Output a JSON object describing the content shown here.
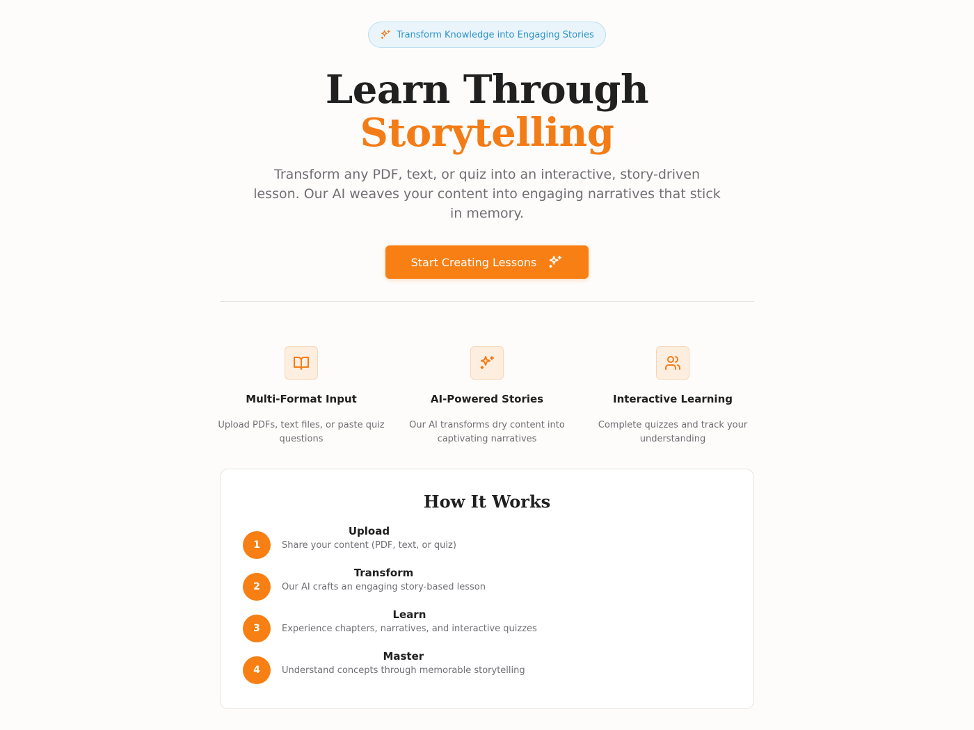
{
  "badge": {
    "icon": "sparkles-icon",
    "text": "Transform Knowledge into Engaging Stories"
  },
  "hero": {
    "title_line1": "Learn Through",
    "title_line2": "Storytelling",
    "subtitle": "Transform any PDF, text, or quiz into an interactive, story-driven lesson. Our AI weaves your content into engaging narratives that stick in memory.",
    "cta_label": "Start Creating Lessons",
    "cta_icon": "sparkles-icon"
  },
  "features": [
    {
      "icon": "book-open-icon",
      "title": "Multi-Format Input",
      "description": "Upload PDFs, text files, or paste quiz questions"
    },
    {
      "icon": "sparkles-icon",
      "title": "AI-Powered Stories",
      "description": "Our AI transforms dry content into captivating narratives"
    },
    {
      "icon": "users-icon",
      "title": "Interactive Learning",
      "description": "Complete quizzes and track your understanding"
    }
  ],
  "how_it_works": {
    "heading": "How It Works",
    "steps": [
      {
        "number": "1",
        "title": "Upload",
        "description": "Share your content (PDF, text, or quiz)"
      },
      {
        "number": "2",
        "title": "Transform",
        "description": "Our AI crafts an engaging story-based lesson"
      },
      {
        "number": "3",
        "title": "Learn",
        "description": "Experience chapters, narratives, and interactive quizzes"
      },
      {
        "number": "4",
        "title": "Master",
        "description": "Understand concepts through memorable storytelling"
      }
    ]
  },
  "colors": {
    "accent": "#f77f13",
    "badge_text": "#2b93c9",
    "muted_text": "#6f6f75"
  }
}
